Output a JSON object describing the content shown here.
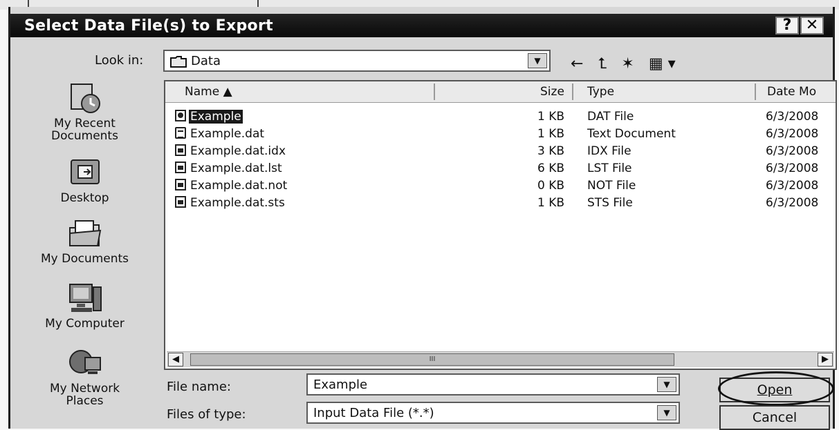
{
  "dialog": {
    "title": "Select Data File(s) to Export",
    "help_glyph": "?",
    "close_glyph": "✕"
  },
  "lookin": {
    "label": "Look in:",
    "value": "Data",
    "toolbar_glyphs": "← ⮤ ✶ ▦▾"
  },
  "places": [
    {
      "label_line1": "My Recent",
      "label_line2": "Documents",
      "icon": "recent-documents-icon"
    },
    {
      "label_line1": "Desktop",
      "label_line2": "",
      "icon": "desktop-icon"
    },
    {
      "label_line1": "My Documents",
      "label_line2": "",
      "icon": "my-documents-icon"
    },
    {
      "label_line1": "My Computer",
      "label_line2": "",
      "icon": "my-computer-icon"
    },
    {
      "label_line1": "My Network",
      "label_line2": "Places",
      "icon": "network-places-icon"
    }
  ],
  "columns": {
    "name": "Name",
    "size": "Size",
    "type": "Type",
    "date": "Date Mo"
  },
  "files": [
    {
      "name": "Example",
      "size": "1 KB",
      "type": "DAT File",
      "date": "6/3/2008",
      "icon": "dat-file-icon"
    },
    {
      "name": "Example.dat",
      "size": "1 KB",
      "type": "Text Document",
      "date": "6/3/2008",
      "icon": "text-document-icon"
    },
    {
      "name": "Example.dat.idx",
      "size": "3 KB",
      "type": "IDX File",
      "date": "6/3/2008",
      "icon": "idx-file-icon"
    },
    {
      "name": "Example.dat.lst",
      "size": "6 KB",
      "type": "LST File",
      "date": "6/3/2008",
      "icon": "lst-file-icon"
    },
    {
      "name": "Example.dat.not",
      "size": "0 KB",
      "type": "NOT File",
      "date": "6/3/2008",
      "icon": "not-file-icon"
    },
    {
      "name": "Example.dat.sts",
      "size": "1 KB",
      "type": "STS File",
      "date": "6/3/2008",
      "icon": "sts-file-icon"
    }
  ],
  "scrollbar": {
    "thumb_grip": "III"
  },
  "filename": {
    "label": "File name:",
    "value": "Example"
  },
  "filetype": {
    "label": "Files of type:",
    "value": "Input Data File (*.*)"
  },
  "buttons": {
    "open": "Open",
    "cancel": "Cancel"
  }
}
